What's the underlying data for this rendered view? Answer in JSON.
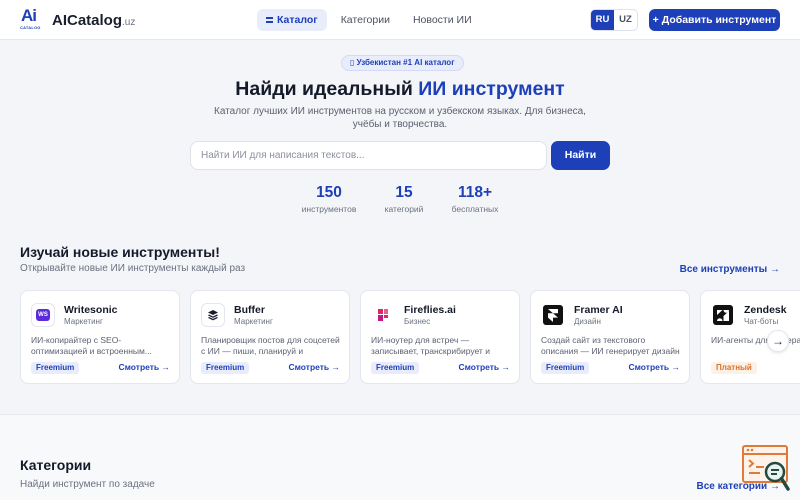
{
  "header": {
    "logo_mark": "Ai",
    "logo_mark_sub": "CATALOG",
    "logo_name": "AICatalog",
    "logo_suffix": ".uz",
    "nav": [
      {
        "label": "Каталог",
        "active": true
      },
      {
        "label": "Категории",
        "active": false
      },
      {
        "label": "Новости ИИ",
        "active": false
      }
    ],
    "lang": [
      "RU",
      "UZ"
    ],
    "lang_active": "RU",
    "add_button": "+ Добавить инструмент"
  },
  "hero": {
    "badge": "▯ Узбекистан #1 AI каталог",
    "title_plain": "Найди идеальный ",
    "title_accent": "ИИ инструмент",
    "subtitle": "Каталог лучших ИИ инструментов на русском и узбекском языках. Для бизнеса, учёбы и творчества.",
    "search_placeholder": "Найти ИИ для написания текстов...",
    "search_button": "Найти",
    "stats": [
      {
        "value": "150",
        "label": "инструментов"
      },
      {
        "value": "15",
        "label": "категорий"
      },
      {
        "value": "118+",
        "label": "бесплатных"
      }
    ]
  },
  "new_tools": {
    "title": "Изучай новые инструменты!",
    "subtitle": "Открывайте новые ИИ инструменты каждый раз",
    "all_link": "Все инструменты →",
    "view_label": "Смотреть →",
    "cards": [
      {
        "name": "Writesonic",
        "category": "Маркетинг",
        "desc": "ИИ-копирайтер с SEO-оптимизацией и встроенным...",
        "tag": "Freemium",
        "icon": "writesonic-icon",
        "icon_text": "WS",
        "icon_bg": "#ffffff"
      },
      {
        "name": "Buffer",
        "category": "Маркетинг",
        "desc": "Планировщик постов для соцсетей с ИИ — пиши, планируй и анализир...",
        "tag": "Freemium",
        "icon": "buffer-icon",
        "icon_text": "",
        "icon_bg": "#ffffff"
      },
      {
        "name": "Fireflies.ai",
        "category": "Бизнес",
        "desc": "ИИ-ноутер для встреч — записывает, транскрибирует и ище...",
        "tag": "Freemium",
        "icon": "fireflies-icon",
        "icon_text": "",
        "icon_bg": "#ffffff"
      },
      {
        "name": "Framer AI",
        "category": "Дизайн",
        "desc": "Создай сайт из текстового описания — ИИ генерирует дизайн и сразу...",
        "tag": "Freemium",
        "icon": "framer-icon",
        "icon_text": "",
        "icon_bg": "#111111"
      },
      {
        "name": "Zendesk",
        "category": "Чат-боты",
        "desc": "ИИ-агенты для лидера рынка —",
        "tag": "Платный",
        "icon": "zendesk-icon",
        "icon_text": "",
        "icon_bg": "#111111"
      }
    ],
    "next_arrow": "→"
  },
  "categories": {
    "title": "Категории",
    "subtitle": "Найди инструмент по задаче",
    "all_link": "Все категории →"
  }
}
